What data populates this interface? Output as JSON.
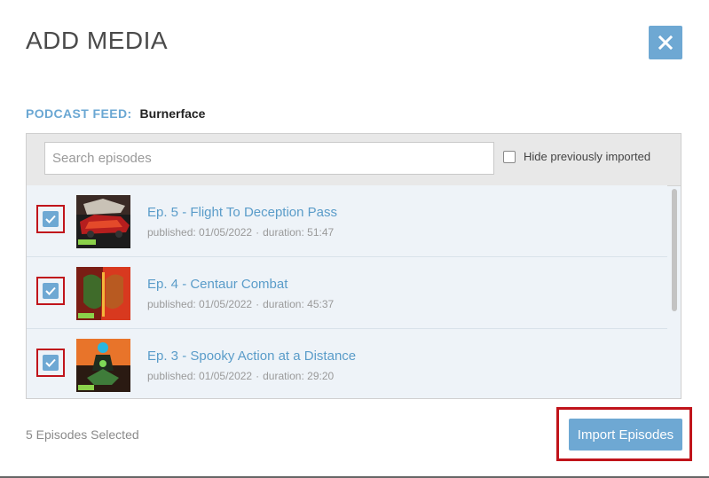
{
  "modal": {
    "title": "ADD MEDIA",
    "close_icon": "close-icon"
  },
  "feed": {
    "label": "PODCAST FEED:",
    "name": "Burnerface"
  },
  "search": {
    "placeholder": "Search episodes",
    "value": ""
  },
  "filter": {
    "hide_previously_imported_label": "Hide previously imported",
    "hide_previously_imported_checked": false
  },
  "episodes": [
    {
      "title": "Ep. 5 - Flight To Deception Pass",
      "published": "published: 01/05/2022",
      "duration": "duration: 51:47",
      "checked": true,
      "thumbnail_icon": "episode-artwork-car"
    },
    {
      "title": "Ep. 4 - Centaur Combat",
      "published": "published: 01/05/2022",
      "duration": "duration: 45:37",
      "checked": true,
      "thumbnail_icon": "episode-artwork-faces"
    },
    {
      "title": "Ep. 3 - Spooky Action at a Distance",
      "published": "published: 01/05/2022",
      "duration": "duration: 29:20",
      "checked": true,
      "thumbnail_icon": "episode-artwork-figure"
    }
  ],
  "footer": {
    "selected_count": "5 Episodes Selected",
    "import_label": "Import Episodes"
  },
  "colors": {
    "accent": "#6ea8d3",
    "link": "#5a9cc9",
    "highlight": "#c0141b"
  }
}
